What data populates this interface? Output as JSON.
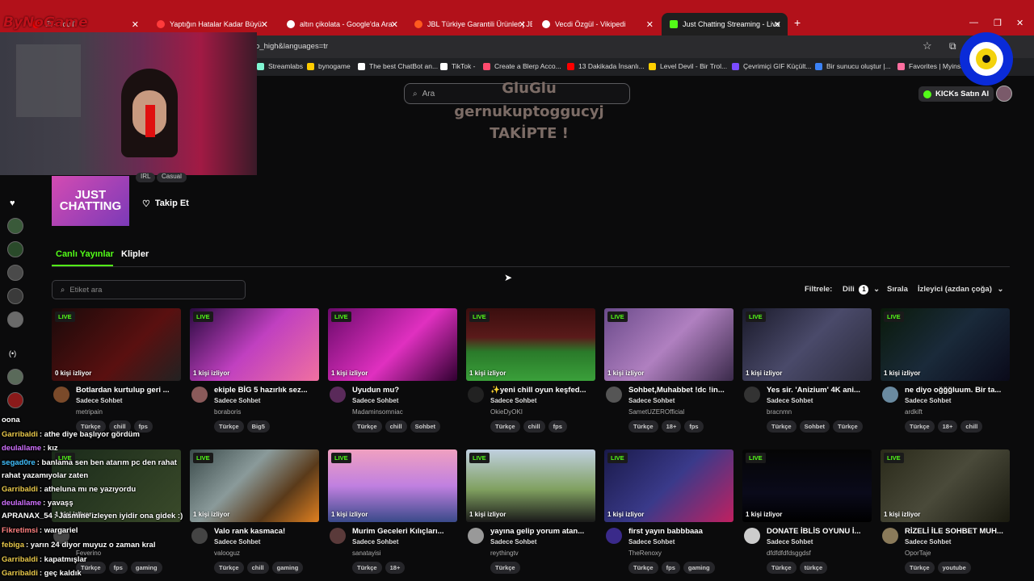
{
  "browser": {
    "tabs": [
      {
        "label": "Et - YouT",
        "fav": "#ff0000"
      },
      {
        "label": "Yaptığın Hatalar Kadar Büyü",
        "fav": "#ff3b3b"
      },
      {
        "label": "altın çikolata - Google'da Ara",
        "fav": "#ffffff"
      },
      {
        "label": "JBL Türkiye Garantili Ürünler | JB",
        "fav": "#ff5a1f"
      },
      {
        "label": "Vecdi Özgül - Vikipedi",
        "fav": "#ffffff"
      },
      {
        "label": "Just Chatting Streaming - Live",
        "fav": "#53fc18"
      }
    ],
    "address_fragment": "o_high&languages=tr",
    "bookmarks": [
      {
        "label": "Streamlabs",
        "color": "#80f5d2"
      },
      {
        "label": "bynogame",
        "color": "#ffcc00"
      },
      {
        "label": "The best ChatBot an...",
        "color": "#ffffff"
      },
      {
        "label": "TikTok -",
        "color": "#ffffff"
      },
      {
        "label": "Create a Blerp Acco...",
        "color": "#ff4b6e"
      },
      {
        "label": "13 Dakikada İnsanlı...",
        "color": "#ff0000"
      },
      {
        "label": "Level Devil - Bir Trol...",
        "color": "#ffd000"
      },
      {
        "label": "Çevrimiçi GIF Küçült...",
        "color": "#7a4bff"
      },
      {
        "label": "Bir sunucu oluştur |...",
        "color": "#3b82f6"
      },
      {
        "label": "Favorites | Myinst",
        "color": "#ff6fa0"
      }
    ]
  },
  "overlay": {
    "logo": "ByNoGame",
    "line1": "GluGlu",
    "line2": "gernukuptoggucyj",
    "line3": "TAKİPTE !"
  },
  "header": {
    "search_placeholder": "Ara",
    "kicks_label": "KICKs Satın Al"
  },
  "category": {
    "cover_text": "JUST CHATTING",
    "chips": [
      "IRL",
      "Casual"
    ],
    "follow_label": "Takip Et"
  },
  "page_tabs": {
    "live": "Canlı Yayınlar",
    "clips": "Klipler"
  },
  "filters": {
    "tag_placeholder": "Etiket ara",
    "label": "Filtrele:",
    "language": "Dili",
    "language_count": "1",
    "sort_label": "Sırala",
    "sort_value": "İzleyici (azdan çoğa)"
  },
  "streams_row1": [
    {
      "thumb": "linear-gradient(135deg,#1a0a0a,#5a1010 60%,#222)",
      "viewers": "0 kişi izliyor",
      "title": "Botlardan kurtulup geri ...",
      "category": "Sadece Sohbet",
      "user": "metripain",
      "tags": [
        "Türkçe",
        "chill",
        "fps"
      ],
      "av": "#7a4a2a"
    },
    {
      "thumb": "linear-gradient(135deg,#2a0a40,#c040c0 50%,#f070a0)",
      "viewers": "1 kişi izliyor",
      "title": "ekiple BİG 5 hazırlık sez...",
      "category": "Sadece Sohbet",
      "user": "boraboris",
      "tags": [
        "Türkçe",
        "Big5"
      ],
      "av": "#8a5a5a"
    },
    {
      "thumb": "linear-gradient(135deg,#6a0a6a,#e030c0 55%,#300030)",
      "viewers": "1 kişi izliyor",
      "title": "Uyudun mu?",
      "category": "Sadece Sohbet",
      "user": "Madaminsomniac",
      "tags": [
        "Türkçe",
        "chill",
        "Sohbet"
      ],
      "av": "#5a2a5a"
    },
    {
      "thumb": "linear-gradient(180deg,#3a0e0e 0%,#5a1a1a 40%,#2a7a2a 60%,#3aa03a)",
      "viewers": "1 kişi izliyor",
      "title": "✨yeni chill oyun keşfed...",
      "category": "Sadece Sohbet",
      "user": "OkieDyOKI",
      "tags": [
        "Türkçe",
        "chill",
        "fps"
      ],
      "av": "#222"
    },
    {
      "thumb": "linear-gradient(135deg,#6a4a8a,#b080c0 50%,#3a2a4a)",
      "viewers": "1 kişi izliyor",
      "title": "Sohbet,Muhabbet !dc !in...",
      "category": "Sadece Sohbet",
      "user": "SametUZEROfficial",
      "tags": [
        "Türkçe",
        "18+",
        "fps"
      ],
      "av": "#555"
    },
    {
      "thumb": "linear-gradient(135deg,#1a1a2a,#4a4a6a 50%,#2a2a3a)",
      "viewers": "1 kişi izliyor",
      "title": "Yes sir. 'Anizium' 4K ani...",
      "category": "Sadece Sohbet",
      "user": "bracnmn",
      "tags": [
        "Türkçe",
        "Sohbet",
        "Türkçe"
      ],
      "av": "#333"
    },
    {
      "thumb": "linear-gradient(135deg,#0a1a0a,#1a2a3a 50%,#0a0a1a)",
      "viewers": "1 kişi izliyor",
      "title": "ne diyo oğğğluum. Bir ta...",
      "category": "Sadece Sohbet",
      "user": "ardkift",
      "tags": [
        "Türkçe",
        "18+",
        "chill"
      ],
      "av": "#6a8aa0"
    }
  ],
  "streams_row2": [
    {
      "thumb": "linear-gradient(135deg,#1a2a1a,#3a4a2a)",
      "viewers": "1 kişi izliyor",
      "title": "",
      "category": "",
      "user": "Feverino",
      "tags": [
        "Türkçe",
        "fps",
        "gaming"
      ],
      "av": "#444"
    },
    {
      "thumb": "linear-gradient(135deg,#3a4a4a,#8a9a9a 40%,#5a3a1a 70%,#e08020)",
      "viewers": "1 kişi izliyor",
      "title": "Valo rank kasmaca!",
      "category": "Sadece Sohbet",
      "user": "valooguz",
      "tags": [
        "Türkçe",
        "chill",
        "gaming"
      ],
      "av": "#444"
    },
    {
      "thumb": "linear-gradient(180deg,#f0a0c0,#c080e0 50%,#3a4a8a)",
      "viewers": "1 kişi izliyor",
      "title": "Murim Geceleri Kılıçları...",
      "category": "Sadece Sohbet",
      "user": "sanatayisi",
      "tags": [
        "Türkçe",
        "18+"
      ],
      "av": "#5a3a3a"
    },
    {
      "thumb": "linear-gradient(180deg,#c0d0e0,#80a060 55%,#1a1a1a)",
      "viewers": "1 kişi izliyor",
      "title": "yayına gelip yorum atan...",
      "category": "Sadece Sohbet",
      "user": "reythingtv",
      "tags": [
        "Türkçe"
      ],
      "av": "#999"
    },
    {
      "thumb": "linear-gradient(135deg,#1a1a4a,#3a3a8a 50%,#c02060)",
      "viewers": "1 kişi izliyor",
      "title": "first yayın babbbaaa",
      "category": "Sadece Sohbet",
      "user": "TheRenoxy",
      "tags": [
        "Türkçe",
        "fps",
        "gaming"
      ],
      "av": "#3a2a8a"
    },
    {
      "thumb": "linear-gradient(180deg,#050505,#0a0a1a 60%,#000)",
      "viewers": "1 kişi izliyor",
      "title": "DONATE İBLİS OYUNU İ...",
      "category": "Sadece Sohbet",
      "user": "dfdfdfdfdsggdsf",
      "tags": [
        "Türkçe",
        "türkçe"
      ],
      "av": "#ccc"
    },
    {
      "thumb": "linear-gradient(135deg,#2a2a1a,#4a4a3a 50%,#1a1a10)",
      "viewers": "1 kişi izliyor",
      "title": "RİZELİ İLE SOHBET MUH...",
      "category": "Sadece Sohbet",
      "user": "OporTaje",
      "tags": [
        "Türkçe",
        "youtube"
      ],
      "av": "#8a7a5a"
    }
  ],
  "chat": [
    {
      "user": "",
      "text": "oona",
      "color": "#ffffff"
    },
    {
      "user": "Garribaldi",
      "text": ": athe diye başlıyor gördüm",
      "color": "#e8c84a"
    },
    {
      "user": "deulallame",
      "text": ": kız",
      "color": "#d070ff"
    },
    {
      "user": "segad0re",
      "text": ": banlama sen ben atarım pc den rahat",
      "color": "#40c0ff"
    },
    {
      "user": "",
      "text": "rahat yazamıyolar zaten",
      "color": "#ffffff"
    },
    {
      "user": "Garribaldi",
      "text": ": atheluna mı ne yazıyordu",
      "color": "#e8c84a"
    },
    {
      "user": "deulallame",
      "text": ": yavaşş",
      "color": "#d070ff"
    },
    {
      "user": "APRANAX_54",
      "text": ": Jasmine izleyen iyidir ona gidek :)",
      "color": "#ffffff"
    },
    {
      "user": "Fikretimsi",
      "text": ": wargariel",
      "color": "#ff8080"
    },
    {
      "user": "febiga",
      "text": ": yarın 24 diyor muyuz o zaman kral",
      "color": "#e8c84a"
    },
    {
      "user": "Garribaldi",
      "text": ": kapatmışlar",
      "color": "#e8c84a"
    },
    {
      "user": "Garribaldi",
      "text": ": geç kaldık",
      "color": "#e8c84a"
    }
  ]
}
